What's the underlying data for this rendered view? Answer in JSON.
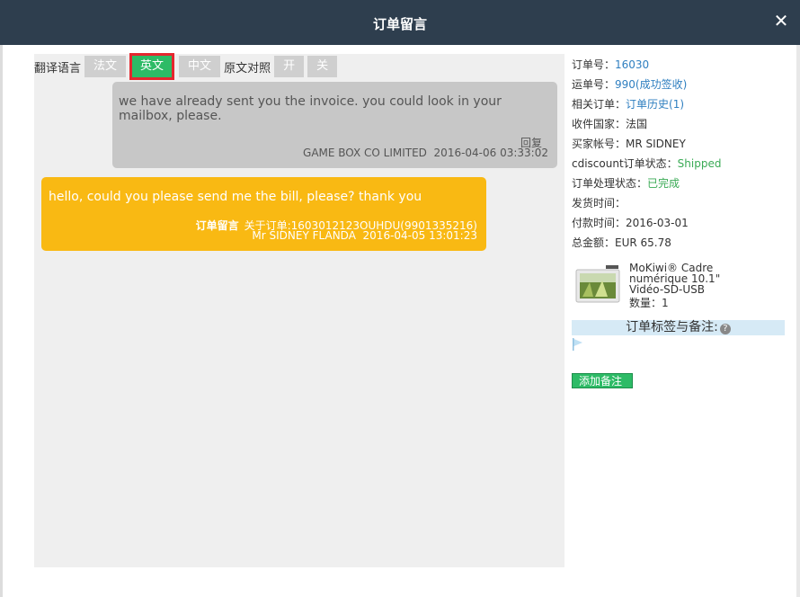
{
  "window": {
    "title": "订单留言"
  },
  "translate": {
    "label": "翻译语言",
    "languages": [
      "法文",
      "英文",
      "中文"
    ],
    "compare_label": "原文对照",
    "on": "开",
    "off": "关"
  },
  "messages": [
    {
      "direction": "incoming",
      "text": "we have already sent you the invoice. you could look in your mailbox, please.",
      "reply_label": "回复",
      "meta": "GAME BOX CO LIMITED  2016-04-06 03:33:02"
    },
    {
      "direction": "outgoing",
      "text": "hello, could you please send me the bill, please? thank you",
      "tag": "订单留言",
      "related": "关于订单:1603012123OUHDU(9901335216)",
      "meta": "Mr SIDNEY FLANDA  2016-04-05 13:01:23"
    }
  ],
  "order": {
    "order_no_label": "订单号：",
    "order_no": "16030",
    "tracking_label": "运单号：",
    "tracking_no": "990",
    "tracking_status": "(成功签收)",
    "related_label": "相关订单：",
    "related_link": "订单历史(1)",
    "country": "收件国家：法国",
    "buyer": "买家帐号：MR SIDNEY",
    "cdiscount_label": "cdiscount订单状态：",
    "cdiscount_status": "Shipped",
    "process_label": "订单处理状态：",
    "process_status": "已完成",
    "ship_time": "发货时间：",
    "pay_time": "付款时间：2016-03-01",
    "total": "总金额：EUR 65.78"
  },
  "product": {
    "name_line1": "MoKiwi® Cadre",
    "name_line2": "numérique 10.1\"",
    "name_line3": "Vidéo-SD-USB",
    "qty": "数量：1"
  },
  "remarks": {
    "header": "订单标签与备注:",
    "help_icon": "question-circle-icon",
    "flag_icon": "flag-icon",
    "add_button": "添加备注"
  },
  "colors": {
    "titlebar": "#2e3e4e",
    "active_lang": "#2dbb66",
    "highlight_border": "#e5262e",
    "outgoing_bubble": "#f9b913",
    "incoming_bubble": "#c7c7c7",
    "link": "#2f7fc0"
  }
}
